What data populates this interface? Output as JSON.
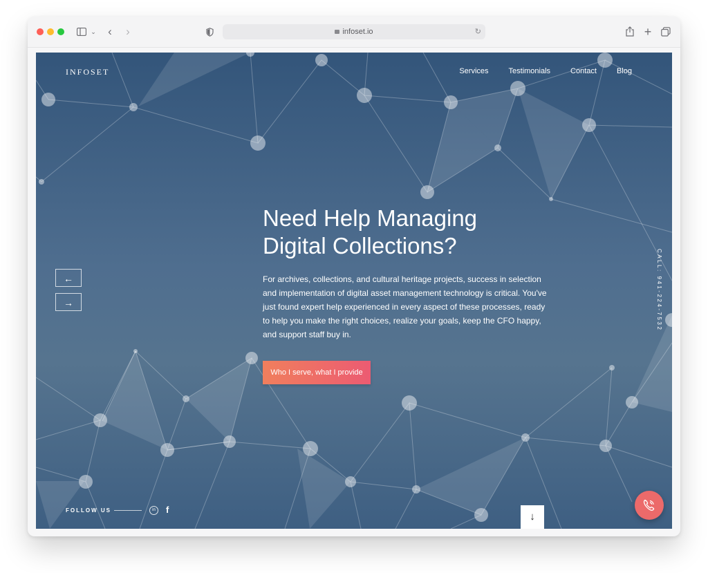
{
  "browser": {
    "url": "infoset.io",
    "icons": {
      "sidebar": "sidebar-icon",
      "back": "chevron-left-icon",
      "forward": "chevron-right-icon",
      "privacy": "shield-icon",
      "reload": "reload-icon",
      "share": "share-icon",
      "new_tab": "plus-icon",
      "tabs": "tabs-overview-icon"
    }
  },
  "site": {
    "logo": "INFOSET",
    "nav": [
      "Services",
      "Testimonials",
      "Contact",
      "Blog"
    ],
    "hero": {
      "title_line1": "Need Help Managing",
      "title_line2": "Digital Collections?",
      "body": "For archives, collections, and cultural heritage projects, success in selection and implementation of digital asset management technology is critical. You've just found expert help experienced in every aspect of these processes, ready to help you make the right choices, realize your goals, keep the CFO happy, and support staff buy in.",
      "cta": "Who I serve, what I provide"
    },
    "slider": {
      "prev_icon": "arrow-left-icon",
      "next_icon": "arrow-right-icon"
    },
    "call_text": "CALL: 941-224-7532",
    "follow_label": "FOLLOW US",
    "social": {
      "linkedin": "in",
      "facebook": "f"
    },
    "scroll_icon": "arrow-down-icon",
    "phone_icon": "phone-icon"
  },
  "colors": {
    "hero_top": "#33557a",
    "hero_bottom": "#3e5f82",
    "cta_start": "#f07f5d",
    "cta_end": "#ec5b72",
    "phone_fab": "#ec6a6a"
  }
}
